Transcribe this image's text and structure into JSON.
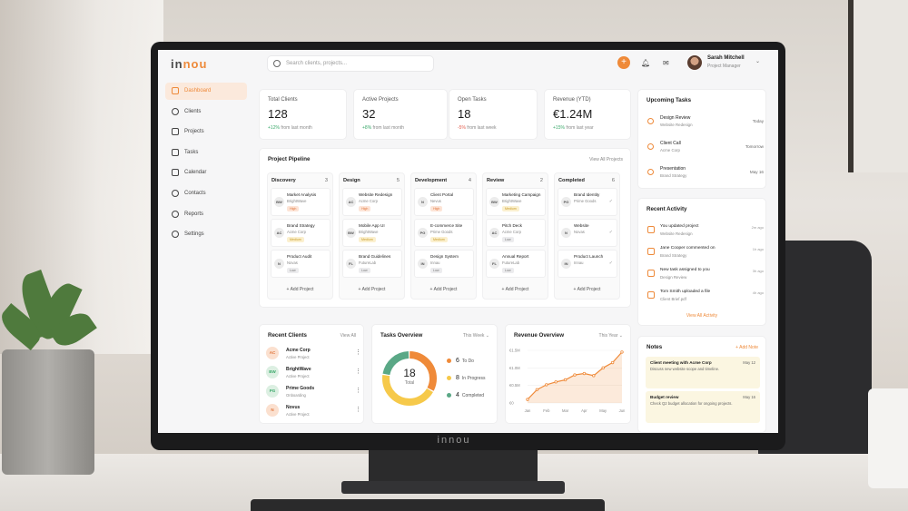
{
  "app": {
    "logo_text_a": "in",
    "logo_text_b": "nou",
    "monitor_brand": "innou"
  },
  "search": {
    "placeholder": "Search clients, projects..."
  },
  "user": {
    "name": "Sarah Mitchell",
    "role": "Project Manager"
  },
  "sidebar": {
    "items": [
      {
        "label": "Dashboard",
        "active": true
      },
      {
        "label": "Clients"
      },
      {
        "label": "Projects"
      },
      {
        "label": "Tasks"
      },
      {
        "label": "Calendar"
      },
      {
        "label": "Contacts"
      },
      {
        "label": "Reports"
      },
      {
        "label": "Settings"
      }
    ]
  },
  "stats": [
    {
      "label": "Total Clients",
      "value": "128",
      "delta": "+12%",
      "period": "from last month",
      "trend": "up"
    },
    {
      "label": "Active Projects",
      "value": "32",
      "delta": "+8%",
      "period": "from last month",
      "trend": "up"
    },
    {
      "label": "Open Tasks",
      "value": "18",
      "delta": "-5%",
      "period": "from last week",
      "trend": "down"
    },
    {
      "label": "Revenue (YTD)",
      "value": "€1.24M",
      "delta": "+15%",
      "period": "from last year",
      "trend": "up"
    }
  ],
  "pipeline": {
    "title": "Project Pipeline",
    "link": "View All Projects",
    "add_label": "+ Add Project",
    "columns": [
      {
        "name": "Discovery",
        "count": "3",
        "cards": [
          {
            "title": "Market Analysis",
            "client": "BrightWave",
            "initials": "BW",
            "tag": "High",
            "tag_type": "high"
          },
          {
            "title": "Brand Strategy",
            "client": "Acme Corp",
            "initials": "AC",
            "tag": "Medium",
            "tag_type": "medium"
          },
          {
            "title": "Product Audit",
            "client": "Novas",
            "initials": "N",
            "tag": "Low",
            "tag_type": "low"
          }
        ]
      },
      {
        "name": "Design",
        "count": "5",
        "cards": [
          {
            "title": "Website Redesign",
            "client": "Acme Corp",
            "initials": "AC",
            "tag": "High",
            "tag_type": "high"
          },
          {
            "title": "Mobile App UI",
            "client": "BrightWave",
            "initials": "BW",
            "tag": "Medium",
            "tag_type": "medium"
          },
          {
            "title": "Brand Guidelines",
            "client": "FutureLab",
            "initials": "FL",
            "tag": "Low",
            "tag_type": "low"
          }
        ]
      },
      {
        "name": "Development",
        "count": "4",
        "cards": [
          {
            "title": "Client Portal",
            "client": "Nevus",
            "initials": "N",
            "tag": "High",
            "tag_type": "high"
          },
          {
            "title": "E-commerce Site",
            "client": "Prime Goods",
            "initials": "PG",
            "tag": "Medium",
            "tag_type": "medium"
          },
          {
            "title": "Design System",
            "client": "Innau",
            "initials": "IN",
            "tag": "Low",
            "tag_type": "low"
          }
        ]
      },
      {
        "name": "Review",
        "count": "2",
        "cards": [
          {
            "title": "Marketing Campaign",
            "client": "BrightWave",
            "initials": "BW",
            "tag": "Medium",
            "tag_type": "medium"
          },
          {
            "title": "Pitch Deck",
            "client": "Acme Corp",
            "initials": "AC",
            "tag": "Low",
            "tag_type": "low"
          },
          {
            "title": "Annual Report",
            "client": "FutureLab",
            "initials": "FL",
            "tag": "Low",
            "tag_type": "low"
          }
        ]
      },
      {
        "name": "Completed",
        "count": "6",
        "cards": [
          {
            "title": "Brand Identity",
            "client": "Prime Goods",
            "initials": "PG",
            "tag": "",
            "tag_type": "",
            "check": "✓"
          },
          {
            "title": "Website",
            "client": "Novas",
            "initials": "N",
            "tag": "",
            "tag_type": "",
            "check": "✓"
          },
          {
            "title": "Product Launch",
            "client": "Innau",
            "initials": "IN",
            "tag": "",
            "tag_type": "",
            "check": "✓"
          }
        ]
      }
    ]
  },
  "recent_clients": {
    "title": "Recent Clients",
    "link": "View All",
    "items": [
      {
        "initials": "AC",
        "name": "Acme Corp",
        "status": "Active Project",
        "bg": "#fbe0cf",
        "fg": "#e0763d"
      },
      {
        "initials": "BW",
        "name": "BrightWave",
        "status": "Active Project",
        "bg": "#dcefe2",
        "fg": "#3aa86a"
      },
      {
        "initials": "PG",
        "name": "Prime Goods",
        "status": "Onboarding",
        "bg": "#dcefe2",
        "fg": "#3aa86a"
      },
      {
        "initials": "N",
        "name": "Novus",
        "status": "Active Project",
        "bg": "#fbe0cf",
        "fg": "#e0763d"
      }
    ]
  },
  "tasks_overview": {
    "title": "Tasks Overview",
    "period": "This Week",
    "total": "18",
    "total_label": "Total",
    "segments": [
      {
        "count": "6",
        "label": "To Do",
        "value": 6,
        "color": "#ef8a39"
      },
      {
        "count": "8",
        "label": "In Progress",
        "value": 8,
        "color": "#f6c94a"
      },
      {
        "count": "4",
        "label": "Completed",
        "value": 4,
        "color": "#5aa886"
      }
    ]
  },
  "chart_data": {
    "type": "area",
    "title": "Revenue Overview",
    "period": "This Year",
    "categories": [
      "Jan",
      "Feb",
      "Mar",
      "Apr",
      "May",
      "Jun"
    ],
    "y_tick_labels": [
      "€1.5M",
      "€1.0M",
      "€0.5M",
      "€0"
    ],
    "x": [
      0,
      0.5,
      1,
      1.5,
      2,
      2.5,
      3,
      3.5,
      4,
      4.5,
      5
    ],
    "values": [
      0.1,
      0.38,
      0.52,
      0.6,
      0.66,
      0.8,
      0.84,
      0.78,
      1.0,
      1.15,
      1.45
    ],
    "ylim": [
      0,
      1.5
    ],
    "color": "#ef8a39",
    "grid": true
  },
  "upcoming_tasks": {
    "title": "Upcoming Tasks",
    "items": [
      {
        "title": "Design Review",
        "sub": "Website Redesign",
        "date": "Today"
      },
      {
        "title": "Client Call",
        "sub": "Acme Corp",
        "date": "Tomorrow"
      },
      {
        "title": "Presentation",
        "sub": "Brand Strategy",
        "date": "May 16"
      }
    ]
  },
  "recent_activity": {
    "title": "Recent Activity",
    "link": "View All Activity",
    "items": [
      {
        "title": "You updated project",
        "sub": "Website Redesign",
        "time": "2m ago"
      },
      {
        "title": "Jane Cooper commented on",
        "sub": "Brand Strategy",
        "time": "1h ago"
      },
      {
        "title": "New task assigned to you",
        "sub": "Design Review",
        "time": "3h ago"
      },
      {
        "title": "Tom Smith uploaded a file",
        "sub": "Client Brief.pdf",
        "time": "4h ago"
      }
    ]
  },
  "notes": {
    "title": "Notes",
    "add_label": "+ Add Note",
    "items": [
      {
        "title": "Client meeting with Acme Corp",
        "body": "Discuss new website scope and timeline.",
        "date": "May 12"
      },
      {
        "title": "Budget review",
        "body": "Check Q2 budget allocation for ongoing projects.",
        "date": "May 16"
      }
    ]
  },
  "colors": {
    "accent": "#ef8a39",
    "positive": "#3aa86a",
    "negative": "#e35d4d"
  }
}
